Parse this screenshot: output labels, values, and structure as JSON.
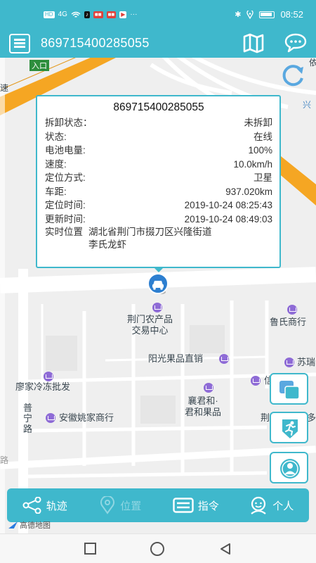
{
  "status_bar": {
    "time": "08:52",
    "indicators": [
      "HD",
      "4G",
      "wifi-icon"
    ],
    "app_chips": [
      "tiktok",
      "news",
      "video",
      "youku"
    ],
    "more": "···"
  },
  "app_bar": {
    "title": "869715400285055",
    "left_icon": "menu-list-icon",
    "right_icons": [
      "map-icon",
      "chat-bubble-icon"
    ]
  },
  "map": {
    "labels": {
      "entrance": "入口",
      "top_right_1": "依",
      "top_right_2": "兴",
      "corner": "速"
    },
    "pois": [
      {
        "name": "荆门农产品\n交易中心"
      },
      {
        "name": "鲁氏商行"
      },
      {
        "name": "阳光果品直销"
      },
      {
        "name": "苏瑞"
      },
      {
        "name": "廖家冷冻批发"
      },
      {
        "name": "襄君和·\n君和果品"
      },
      {
        "name": "信"
      },
      {
        "name": "安徽姚家商行"
      },
      {
        "name": "荆"
      },
      {
        "name": "多"
      }
    ],
    "road_labels": {
      "puning": "普\n宁\n路",
      "bottom_left": "路"
    },
    "attribution": "高德地图"
  },
  "info_window": {
    "title": "869715400285055",
    "rows": [
      {
        "label": "拆卸状态：",
        "value": "未拆卸"
      },
      {
        "label": "状态:",
        "value": "在线"
      },
      {
        "label": "电池电量:",
        "value": "100%"
      },
      {
        "label": "速度:",
        "value": "10.0km/h"
      },
      {
        "label": "定位方式:",
        "value": "卫星"
      },
      {
        "label": "车距:",
        "value": "937.020km"
      },
      {
        "label": "定位时间:",
        "value": "2019-10-24 08:25:43"
      },
      {
        "label": "更新时间:",
        "value": "2019-10-24 08:49:03"
      }
    ],
    "address": {
      "label": "实时位置",
      "value": "湖北省荆门市掇刀区兴隆街道\n李氏龙虾"
    }
  },
  "side_buttons": [
    "layers-icon",
    "running-person-icon",
    "person-circle-icon"
  ],
  "bottom_nav": {
    "items": [
      {
        "label": "轨迹",
        "icon": "share-path-icon"
      },
      {
        "label": "位置",
        "icon": "location-pin-icon"
      },
      {
        "label": "指令",
        "icon": "command-list-icon"
      },
      {
        "label": "个人",
        "icon": "user-face-icon"
      }
    ]
  },
  "colors": {
    "primary": "#3fb8cc",
    "poi": "#8e6bd6",
    "highway": "#f5a623"
  }
}
